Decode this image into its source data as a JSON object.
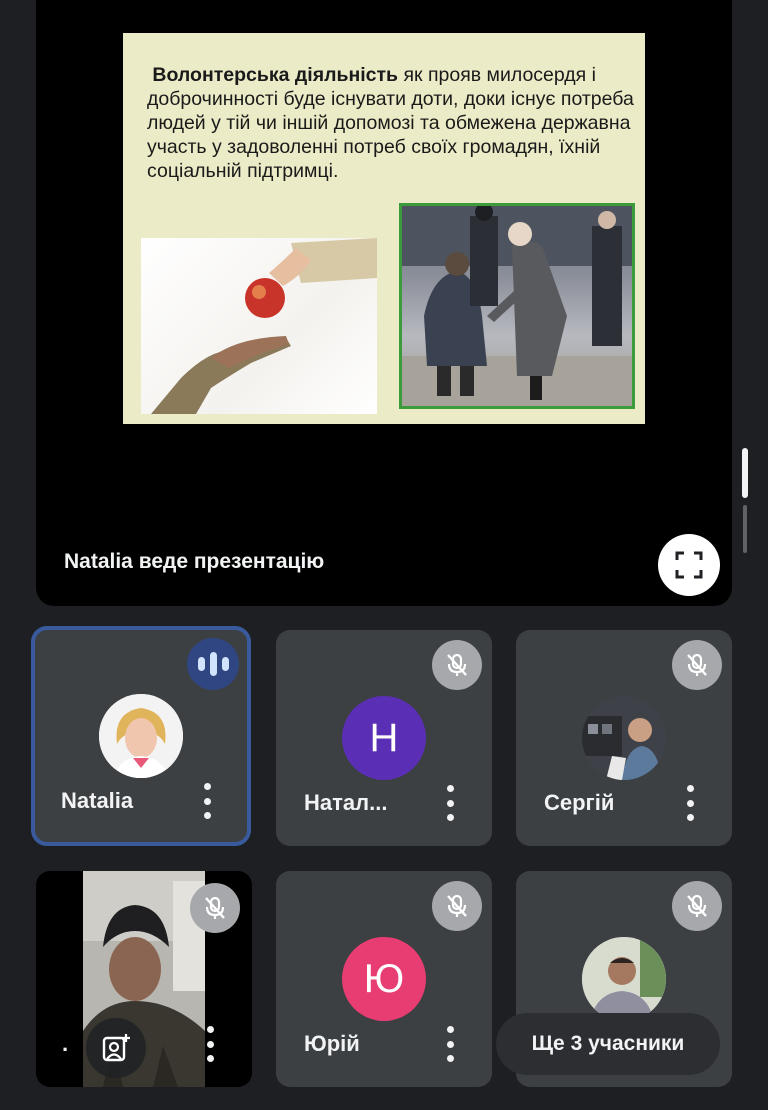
{
  "slide": {
    "bold_text": "Волонтерська діяльність",
    "text": " як прояв милосердя і доброчинності буде існувати доти, доки існує потреба людей у тій чи іншій допомозі та обмежена державна участь у задоволенні потреб своїх громадян, їхній соціальній підтримці."
  },
  "presenter_label": "Natalia веде презентацію",
  "participants": [
    {
      "name": "Natalia",
      "initial": "",
      "state": "speaking"
    },
    {
      "name": "Натал...",
      "initial": "Н",
      "color": "#5b2fb5",
      "state": "muted"
    },
    {
      "name": "Сергій",
      "initial": "",
      "state": "muted"
    },
    {
      "name": ".",
      "initial": "",
      "state": "muted"
    },
    {
      "name": "Юрій",
      "initial": "Ю",
      "color": "#e83d72",
      "state": "muted"
    },
    {
      "name": "",
      "initial": "",
      "state": "muted"
    }
  ],
  "more_participants_label": "Ще 3 учасники",
  "colors": {
    "active_border": "#395a9c",
    "tile_bg": "#3c4043",
    "stage_bg": "#000000"
  }
}
